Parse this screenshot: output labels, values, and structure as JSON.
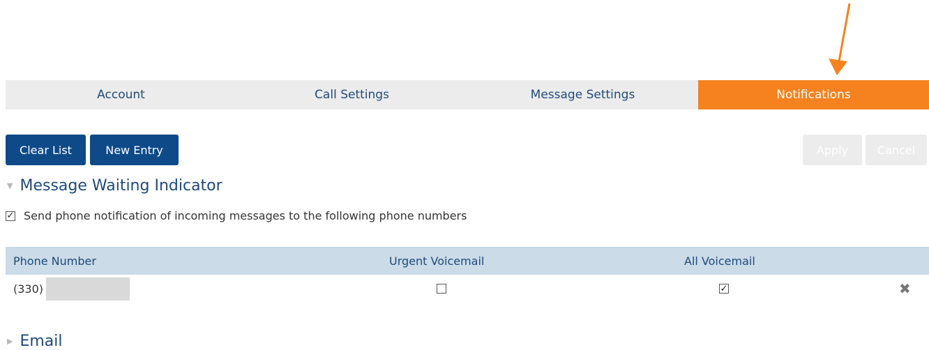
{
  "tabs": [
    {
      "label": "Account",
      "active": false
    },
    {
      "label": "Call Settings",
      "active": false
    },
    {
      "label": "Message Settings",
      "active": false
    },
    {
      "label": "Notifications",
      "active": true
    }
  ],
  "toolbar": {
    "clear_list_label": "Clear List",
    "new_entry_label": "New Entry",
    "apply_label": "Apply",
    "cancel_label": "Cancel"
  },
  "mwi": {
    "title": "Message Waiting Indicator",
    "expanded": true,
    "send_notification_label": "Send phone notification of incoming messages to the following phone numbers",
    "send_notification_checked": true,
    "columns": [
      "Phone Number",
      "Urgent Voicemail",
      "All Voicemail"
    ],
    "rows": [
      {
        "phone": "(330)",
        "urgent_voicemail": false,
        "all_voicemail": true
      }
    ]
  },
  "email": {
    "title": "Email",
    "expanded": false
  },
  "colors": {
    "accent": "#f5821f",
    "primary_button": "#0d4a87",
    "header_text": "#1f4a7a",
    "table_header_bg": "#cbdbe8"
  },
  "icons": {
    "remove": "remove-x-icon",
    "expanded": "triangle-down-icon",
    "collapsed": "triangle-right-icon"
  }
}
